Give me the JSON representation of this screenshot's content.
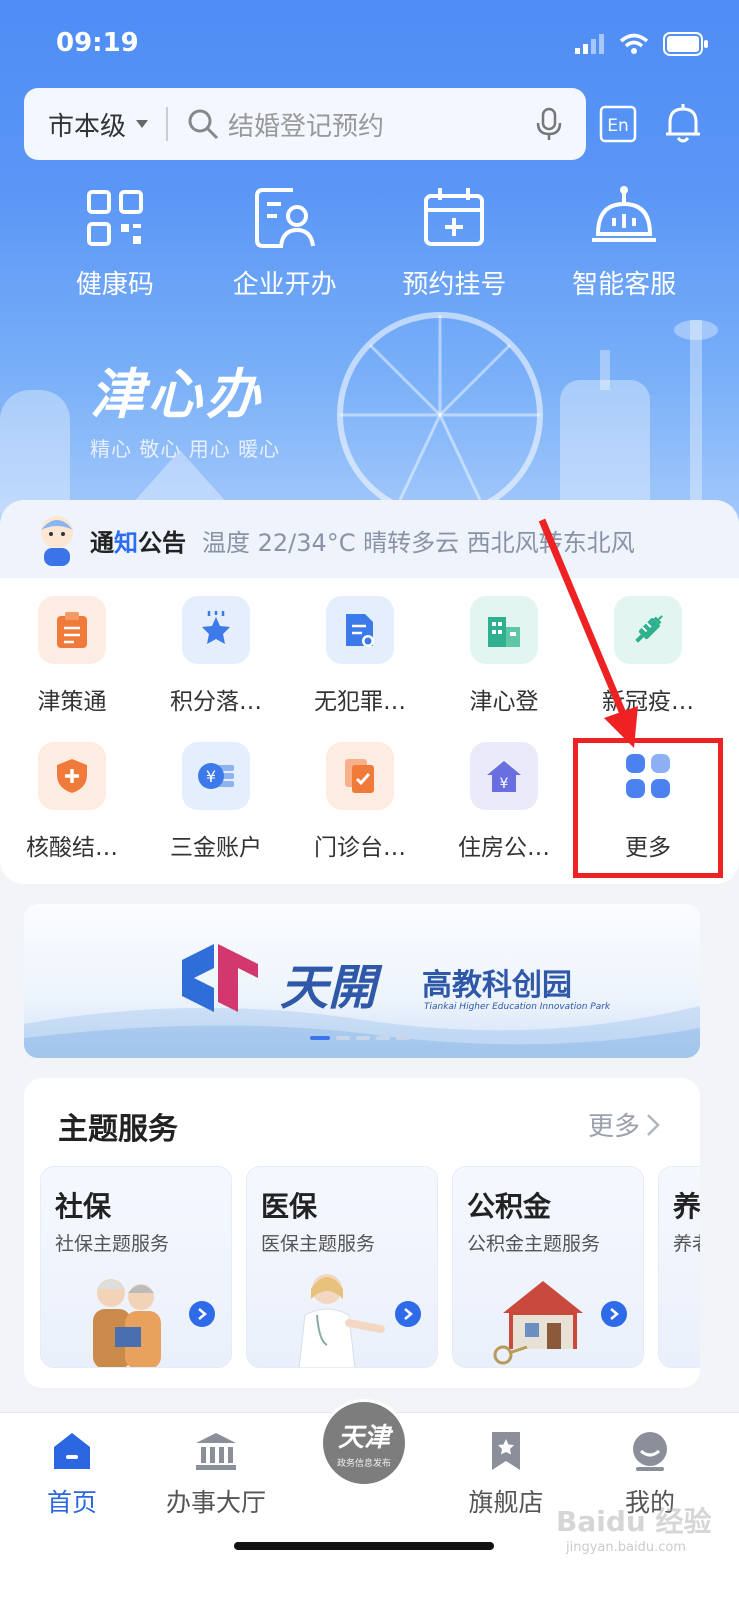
{
  "status": {
    "time": "09:19"
  },
  "search": {
    "region": "市本级",
    "placeholder": "结婚登记预约",
    "lang_label": "En"
  },
  "quick_actions": [
    {
      "label": "健康码",
      "icon": "qr-code-icon"
    },
    {
      "label": "企业开办",
      "icon": "business-registration-icon"
    },
    {
      "label": "预约挂号",
      "icon": "calendar-plus-icon"
    },
    {
      "label": "智能客服",
      "icon": "robot-icon"
    }
  ],
  "brand": {
    "title": "津心办",
    "subtitle": "精心 敬心 用心 暖心"
  },
  "notice": {
    "title_a": "通",
    "title_b": "知",
    "title_c": "公告",
    "text": "温度 22/34°C 晴转多云 西北风转东北风"
  },
  "services": [
    {
      "label": "津策通",
      "icon": "clipboard-icon",
      "bg": "#fdece2",
      "color": "#f07a3a"
    },
    {
      "label": "积分落…",
      "icon": "star-icon",
      "bg": "#e4eefc",
      "color": "#3b7ae8"
    },
    {
      "label": "无犯罪…",
      "icon": "certificate-doc-icon",
      "bg": "#e4eefc",
      "color": "#3b7ae8"
    },
    {
      "label": "津心登",
      "icon": "building-icon",
      "bg": "#e2f5f0",
      "color": "#2fb08e"
    },
    {
      "label": "新冠疫…",
      "icon": "syringe-icon",
      "bg": "#e2f5f0",
      "color": "#2fb08e"
    },
    {
      "label": "核酸结…",
      "icon": "shield-plus-icon",
      "bg": "#fdece2",
      "color": "#f07a3a"
    },
    {
      "label": "三金账户",
      "icon": "yen-coin-icon",
      "bg": "#e4eefc",
      "color": "#3b7ae8"
    },
    {
      "label": "门诊台…",
      "icon": "medical-record-icon",
      "bg": "#fdece2",
      "color": "#f07a3a"
    },
    {
      "label": "住房公…",
      "icon": "house-yen-icon",
      "bg": "#ebeafb",
      "color": "#6a6fe0"
    },
    {
      "label": "更多",
      "icon": "grid-more-icon",
      "bg": "#ffffff",
      "color": "#4c82f0"
    }
  ],
  "banner": {
    "title_cn": "天開",
    "title": "高教科创园",
    "title_en": "Tiankai Higher Education Innovation Park"
  },
  "theme": {
    "title": "主题服务",
    "more": "更多",
    "cards": [
      {
        "title": "社保",
        "subtitle": "社保主题服务"
      },
      {
        "title": "医保",
        "subtitle": "医保主题服务"
      },
      {
        "title": "公积金",
        "subtitle": "公积金主题服务"
      },
      {
        "title": "养",
        "subtitle": "养老"
      }
    ]
  },
  "tabbar": {
    "items": [
      {
        "label": "首页",
        "active": true
      },
      {
        "label": "办事大厅",
        "active": false
      },
      {
        "label": "旗舰店",
        "active": false
      },
      {
        "label": "我的",
        "active": false
      }
    ],
    "emblem_big": "天津",
    "emblem_small": "政务信息发布"
  },
  "watermark": {
    "text": "Baidu 经验",
    "sub": "jingyan.baidu.com"
  },
  "colors": {
    "primary": "#2b67e0",
    "highlight": "#ee2222",
    "hero_top": "#4f8df5"
  }
}
